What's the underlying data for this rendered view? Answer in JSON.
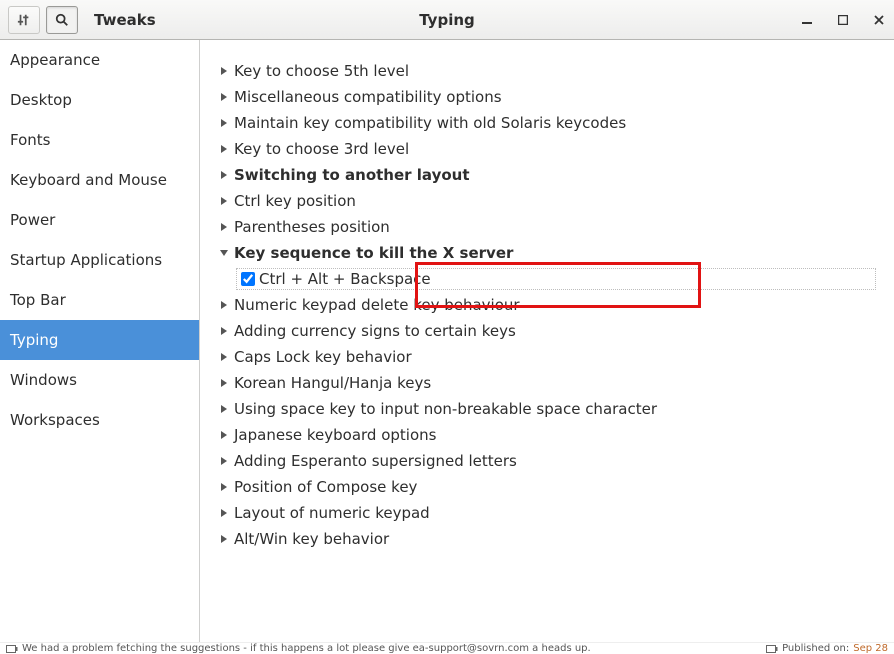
{
  "titlebar": {
    "app_name": "Tweaks",
    "page_title": "Typing"
  },
  "sidebar": {
    "items": [
      {
        "label": "Appearance",
        "selected": false
      },
      {
        "label": "Desktop",
        "selected": false
      },
      {
        "label": "Fonts",
        "selected": false
      },
      {
        "label": "Keyboard and Mouse",
        "selected": false
      },
      {
        "label": "Power",
        "selected": false
      },
      {
        "label": "Startup Applications",
        "selected": false
      },
      {
        "label": "Top Bar",
        "selected": false
      },
      {
        "label": "Typing",
        "selected": true
      },
      {
        "label": "Windows",
        "selected": false
      },
      {
        "label": "Workspaces",
        "selected": false
      }
    ]
  },
  "options": {
    "list": [
      {
        "label": "Key to choose 5th level",
        "expanded": false,
        "bold": false
      },
      {
        "label": "Miscellaneous compatibility options",
        "expanded": false,
        "bold": false
      },
      {
        "label": "Maintain key compatibility with old Solaris keycodes",
        "expanded": false,
        "bold": false
      },
      {
        "label": "Key to choose 3rd level",
        "expanded": false,
        "bold": false
      },
      {
        "label": "Switching to another layout",
        "expanded": false,
        "bold": true
      },
      {
        "label": "Ctrl key position",
        "expanded": false,
        "bold": false
      },
      {
        "label": "Parentheses position",
        "expanded": false,
        "bold": false
      },
      {
        "label": "Key sequence to kill the X server",
        "expanded": true,
        "bold": true,
        "child": {
          "label": "Ctrl + Alt + Backspace",
          "checked": true
        }
      },
      {
        "label": "Numeric keypad delete key behaviour",
        "expanded": false,
        "bold": false
      },
      {
        "label": "Adding currency signs to certain keys",
        "expanded": false,
        "bold": false
      },
      {
        "label": "Caps Lock key behavior",
        "expanded": false,
        "bold": false
      },
      {
        "label": "Korean Hangul/Hanja keys",
        "expanded": false,
        "bold": false
      },
      {
        "label": "Using space key to input non-breakable space character",
        "expanded": false,
        "bold": false
      },
      {
        "label": "Japanese keyboard options",
        "expanded": false,
        "bold": false
      },
      {
        "label": "Adding Esperanto supersigned letters",
        "expanded": false,
        "bold": false
      },
      {
        "label": "Position of Compose key",
        "expanded": false,
        "bold": false
      },
      {
        "label": "Layout of numeric keypad",
        "expanded": false,
        "bold": false
      },
      {
        "label": "Alt/Win key behavior",
        "expanded": false,
        "bold": false
      }
    ]
  },
  "statusbar": {
    "left_text": "We had a problem fetching the suggestions - if this happens a lot please give ea-support@sovrn.com a heads up.",
    "right_prefix": "Published on:",
    "right_date": "Sep 28"
  }
}
